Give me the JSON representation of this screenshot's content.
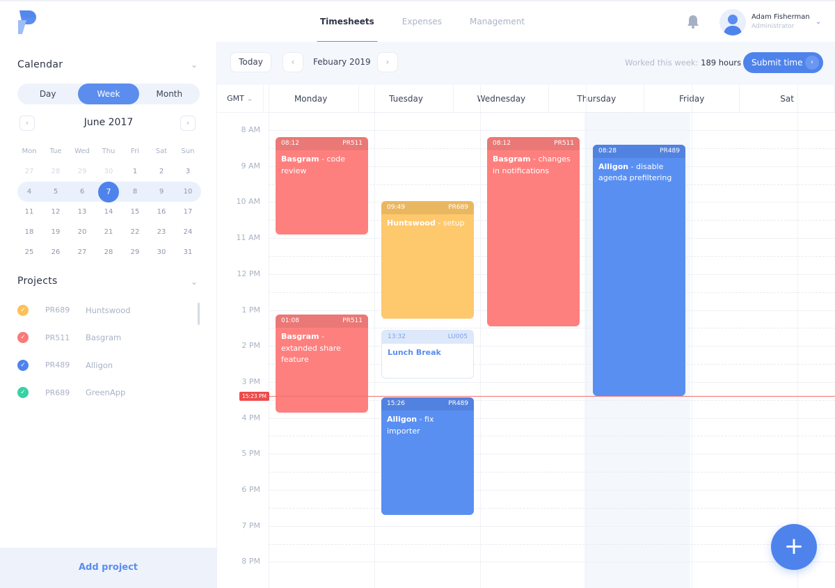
{
  "header": {
    "logo": "app-logo",
    "nav": [
      {
        "label": "Timesheets",
        "active": true
      },
      {
        "label": "Expenses",
        "active": false
      },
      {
        "label": "Management",
        "active": false
      }
    ],
    "user": {
      "name": "Adam Fisherman",
      "role": "Administrator"
    },
    "icons": {
      "bell": "bell-icon",
      "chevron": "⌄"
    }
  },
  "sidebar": {
    "calendar_title": "Calendar",
    "view_toggle": [
      {
        "label": "Day",
        "active": false
      },
      {
        "label": "Week",
        "active": true
      },
      {
        "label": "Month",
        "active": false
      }
    ],
    "mini_calendar": {
      "month_label": "June 2017",
      "prev": "‹",
      "next": "›",
      "weekdays": [
        "Mon",
        "Tue",
        "Wed",
        "Thu",
        "Fri",
        "Sat",
        "Sun"
      ],
      "weeks": [
        [
          {
            "d": "27",
            "dim": true
          },
          {
            "d": "28",
            "dim": true
          },
          {
            "d": "29",
            "dim": true
          },
          {
            "d": "30",
            "dim": true
          },
          {
            "d": "1"
          },
          {
            "d": "2"
          },
          {
            "d": "3"
          }
        ],
        [
          {
            "d": "4"
          },
          {
            "d": "5"
          },
          {
            "d": "6"
          },
          {
            "d": "7",
            "today": true
          },
          {
            "d": "8"
          },
          {
            "d": "9"
          },
          {
            "d": "10"
          }
        ],
        [
          {
            "d": "11"
          },
          {
            "d": "12"
          },
          {
            "d": "13"
          },
          {
            "d": "14"
          },
          {
            "d": "15"
          },
          {
            "d": "16"
          },
          {
            "d": "17"
          }
        ],
        [
          {
            "d": "18"
          },
          {
            "d": "19"
          },
          {
            "d": "20"
          },
          {
            "d": "21"
          },
          {
            "d": "22"
          },
          {
            "d": "23"
          },
          {
            "d": "24"
          }
        ],
        [
          {
            "d": "25"
          },
          {
            "d": "26"
          },
          {
            "d": "27"
          },
          {
            "d": "28"
          },
          {
            "d": "29"
          },
          {
            "d": "30"
          },
          {
            "d": "31"
          }
        ]
      ],
      "selected_week_index": 1
    },
    "projects_title": "Projects",
    "projects": [
      {
        "code": "PR689",
        "name": "Huntswood",
        "color": "#fdc05a"
      },
      {
        "code": "PR511",
        "name": "Basgram",
        "color": "#f77b79"
      },
      {
        "code": "PR489",
        "name": "Alligon",
        "color": "#4f83ec"
      },
      {
        "code": "PR689",
        "name": "GreenApp",
        "color": "#36d2a3"
      }
    ],
    "add_project_label": "Add project"
  },
  "toolbar": {
    "today_label": "Today",
    "prev": "‹",
    "next": "›",
    "period_label": "Febuary 2019",
    "worked_label": "Worked this week:",
    "worked_value": "189 hours",
    "submit_label": "Submit time",
    "submit_arrow": "›"
  },
  "grid": {
    "timezone_label": "GMT",
    "timezone_chevron": "⌄",
    "days": [
      "Monday",
      "Tuesday",
      "Wednesday",
      "Thursday",
      "Friday",
      "Sat"
    ],
    "highlighted_day": "Thursday",
    "hours": [
      "8 AM",
      "9 AM",
      "10 AM",
      "11 AM",
      "12 PM",
      "1 PM",
      "2 PM",
      "3 PM",
      "4 PM",
      "5 PM",
      "6 PM",
      "7 PM",
      "8 PM"
    ],
    "now_label": "15:23 PM",
    "now_hour": 15.38,
    "events": [
      {
        "day": 0,
        "start": 8.2,
        "end": 10.9,
        "color": "red",
        "time": "08:12",
        "code": "PR511",
        "project": "Basgram",
        "task": "code review"
      },
      {
        "day": 0,
        "start": 13.13,
        "end": 15.85,
        "color": "red",
        "time": "01:08",
        "code": "PR511",
        "project": "Basgram",
        "task": "extanded share feature"
      },
      {
        "day": 1,
        "start": 9.97,
        "end": 13.25,
        "color": "yel",
        "time": "09:49",
        "code": "PR689",
        "project": "Huntswood",
        "task": "setup"
      },
      {
        "day": 1,
        "start": 13.55,
        "end": 14.9,
        "color": "lunch",
        "time": "13:32",
        "code": "LU005",
        "project": "Lunch Break",
        "task": ""
      },
      {
        "day": 1,
        "start": 15.43,
        "end": 18.7,
        "color": "blue",
        "time": "15:26",
        "code": "PR489",
        "project": "Alligon",
        "task": "fix importer"
      },
      {
        "day": 2,
        "start": 8.2,
        "end": 13.45,
        "color": "red",
        "time": "08:12",
        "code": "PR511",
        "project": "Basgram",
        "task": "changes in notifications"
      },
      {
        "day": 3,
        "start": 8.4,
        "end": 15.38,
        "color": "blue",
        "time": "08:28",
        "code": "PR489",
        "project": "Alligon",
        "task": "disable agenda prefiltering"
      }
    ]
  },
  "fab_label": "+"
}
